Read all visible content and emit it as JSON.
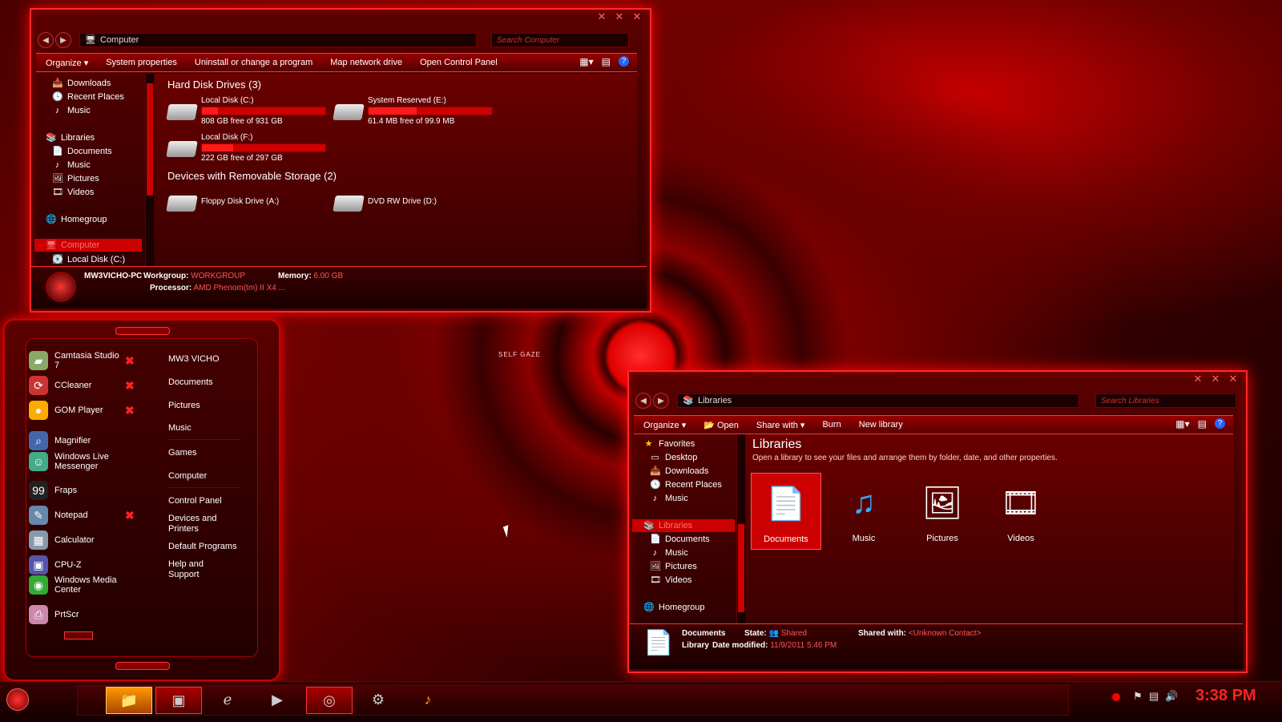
{
  "colors": {
    "accent": "#ff1a1a",
    "bg": "#3a0000",
    "selected": "#cc0000"
  },
  "computer_window": {
    "address": "Computer",
    "search_placeholder": "Search Computer",
    "toolbar": {
      "organize": "Organize ▾",
      "system_properties": "System properties",
      "uninstall": "Uninstall or change a program",
      "map_drive": "Map network drive",
      "control_panel": "Open Control Panel"
    },
    "nav": {
      "downloads": "Downloads",
      "recent": "Recent Places",
      "music": "Music",
      "libraries": "Libraries",
      "documents": "Documents",
      "music2": "Music",
      "pictures": "Pictures",
      "videos": "Videos",
      "homegroup": "Homegroup",
      "computer": "Computer",
      "local_c": "Local Disk (C:)"
    },
    "groups": {
      "hdd": "Hard Disk Drives (3)",
      "removable": "Devices with Removable Storage (2)"
    },
    "drives": [
      {
        "name": "Local Disk (C:)",
        "free": "808 GB free of 931 GB",
        "used_fraction": 0.13
      },
      {
        "name": "System Reserved (E:)",
        "free": "61.4 MB free of 99.9 MB",
        "used_fraction": 0.39
      },
      {
        "name": "Local Disk (F:)",
        "free": "222 GB free of 297 GB",
        "used_fraction": 0.25
      }
    ],
    "removable": [
      {
        "name": "Floppy Disk Drive (A:)"
      },
      {
        "name": "DVD RW Drive (D:)"
      }
    ],
    "status": {
      "pc_name": "MW3VICHO-PC",
      "workgroup_label": "Workgroup:",
      "workgroup": "WORKGROUP",
      "memory_label": "Memory:",
      "memory": "6.00 GB",
      "processor_label": "Processor:",
      "processor": "AMD Phenom(tm) II X4 ..."
    }
  },
  "start_menu": {
    "programs": [
      {
        "label": "Camtasia Studio 7",
        "icon": "camtasia-icon",
        "pinned": true
      },
      {
        "label": "CCleaner",
        "icon": "ccleaner-icon",
        "pinned": true
      },
      {
        "label": "GOM Player",
        "icon": "gom-player-icon",
        "pinned": true
      },
      {
        "label": "Magnifier",
        "icon": "magnifier-icon",
        "pinned": false
      },
      {
        "label": "Windows Live Messenger",
        "icon": "messenger-icon",
        "pinned": false
      },
      {
        "label": "Fraps",
        "icon": "fraps-icon",
        "pinned": false
      },
      {
        "label": "Notepad",
        "icon": "notepad-icon",
        "pinned": true
      },
      {
        "label": "Calculator",
        "icon": "calculator-icon",
        "pinned": false
      },
      {
        "label": "CPU-Z",
        "icon": "cpuz-icon",
        "pinned": false
      },
      {
        "label": "Windows Media Center",
        "icon": "media-center-icon",
        "pinned": false
      },
      {
        "label": "PrtScr",
        "icon": "prtscr-icon",
        "pinned": false
      }
    ],
    "right": {
      "user": "MW3 VICHO",
      "documents": "Documents",
      "pictures": "Pictures",
      "music": "Music",
      "games": "Games",
      "computer": "Computer",
      "control_panel": "Control Panel",
      "devices": "Devices and Printers",
      "default_programs": "Default Programs",
      "help": "Help and Support"
    }
  },
  "libraries_window": {
    "address": "Libraries",
    "search_placeholder": "Search Libraries",
    "toolbar": {
      "organize": "Organize ▾",
      "open": "Open",
      "share": "Share with ▾",
      "burn": "Burn",
      "new_library": "New library"
    },
    "nav": {
      "favorites": "Favorites",
      "desktop": "Desktop",
      "downloads": "Downloads",
      "recent": "Recent Places",
      "music": "Music",
      "libraries": "Libraries",
      "documents": "Documents",
      "music2": "Music",
      "pictures": "Pictures",
      "videos": "Videos",
      "homegroup": "Homegroup"
    },
    "title": "Libraries",
    "subtitle": "Open a library to see your files and arrange them by folder, date, and other properties.",
    "items": [
      {
        "label": "Documents"
      },
      {
        "label": "Music"
      },
      {
        "label": "Pictures"
      },
      {
        "label": "Videos"
      }
    ],
    "status": {
      "name": "Documents",
      "type": "Library",
      "state_label": "State:",
      "state": "Shared",
      "modified_label": "Date modified:",
      "modified": "11/9/2011 5:46 PM",
      "shared_with_label": "Shared with:",
      "shared_with": "<Unknown Contact>"
    }
  },
  "taskbar": {
    "clock": "3:38 PM"
  }
}
